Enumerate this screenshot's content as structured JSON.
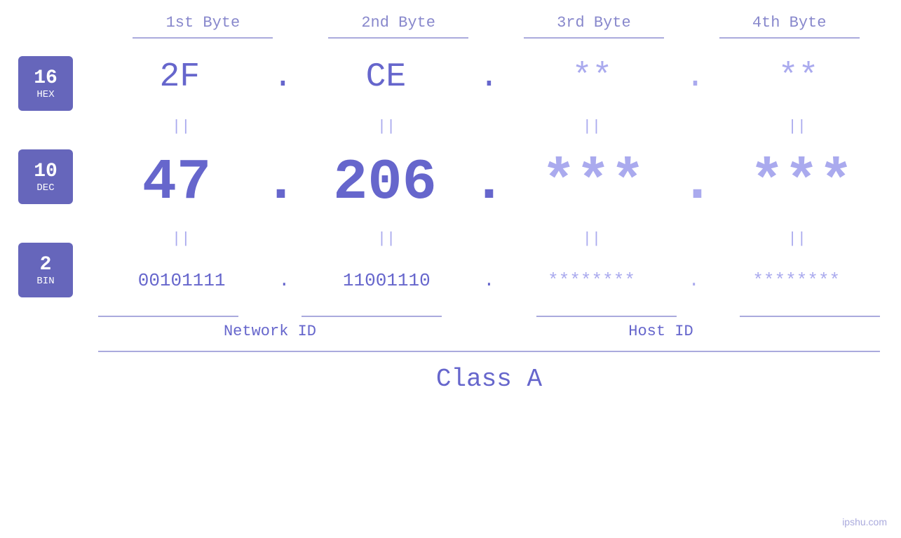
{
  "header": {
    "bytes": [
      "1st Byte",
      "2nd Byte",
      "3rd Byte",
      "4th Byte"
    ]
  },
  "bases": [
    {
      "number": "16",
      "label": "HEX"
    },
    {
      "number": "10",
      "label": "DEC"
    },
    {
      "number": "2",
      "label": "BIN"
    }
  ],
  "rows": {
    "hex": {
      "values": [
        "2F",
        "CE",
        "**",
        "**"
      ],
      "dots": [
        ".",
        ".",
        ".",
        ""
      ]
    },
    "dec": {
      "values": [
        "47",
        "206",
        "***",
        "***"
      ],
      "dots": [
        ".",
        ".",
        ".",
        ""
      ]
    },
    "bin": {
      "values": [
        "00101111",
        "11001110",
        "********",
        "********"
      ],
      "dots": [
        ".",
        ".",
        ".",
        ""
      ]
    }
  },
  "labels": {
    "network_id": "Network ID",
    "host_id": "Host ID",
    "class": "Class A"
  },
  "watermark": "ipshu.com"
}
